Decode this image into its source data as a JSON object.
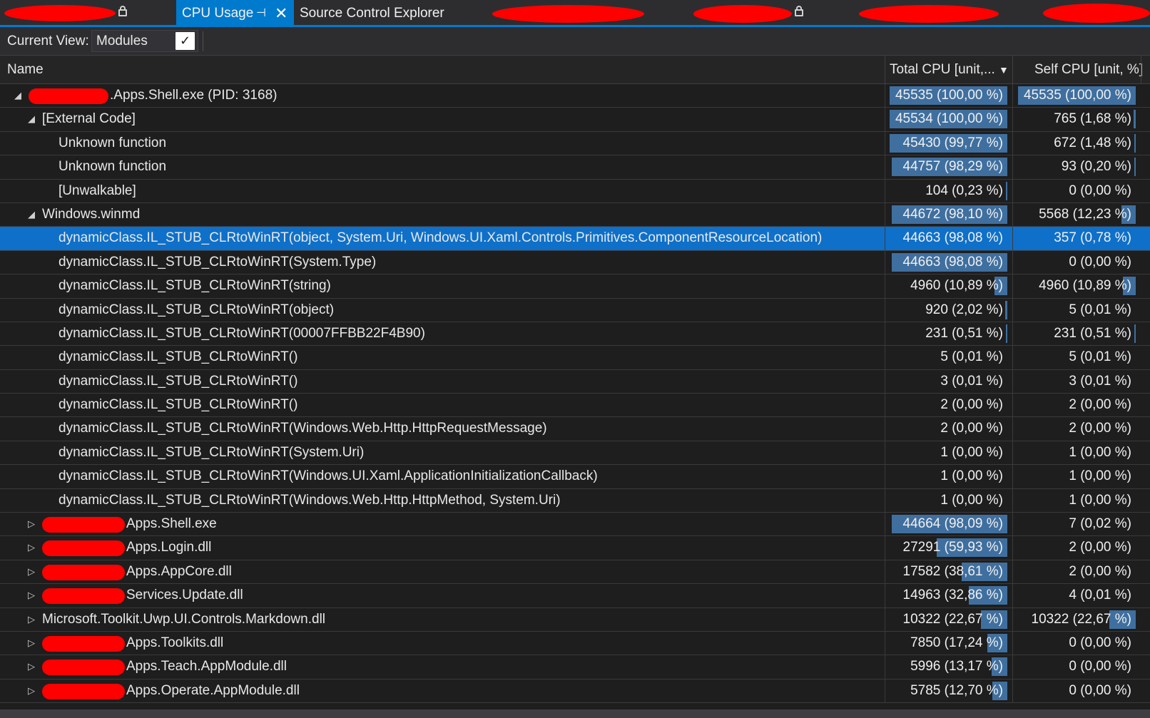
{
  "tabs": {
    "active_label": "CPU Usage",
    "pin_glyph": "⊣",
    "close_glyph": "✕",
    "second_label": "Source Control Explorer"
  },
  "toolbar": {
    "view_label": "Current View:",
    "view_value": "Modules",
    "dropdown_glyph": "✓"
  },
  "columns": {
    "name": "Name",
    "total": "Total CPU [unit,...",
    "self": "Self CPU [unit, %]",
    "sort_glyph": "▼"
  },
  "rows": [
    {
      "name": ".Apps.Shell.exe (PID: 3168)",
      "level": 0,
      "toggle": "◢",
      "redact": true,
      "total": "45535 (100,00 %)",
      "total_pct": 100,
      "self": "45535 (100,00 %)",
      "self_pct": 100
    },
    {
      "name": "[External Code]",
      "level": 1,
      "toggle": "◢",
      "total": "45534 (100,00 %)",
      "total_pct": 100,
      "self": "765 (1,68 %)",
      "self_pct": 1.68
    },
    {
      "name": "Unknown function",
      "level": 2,
      "toggle": "",
      "total": "45430 (99,77 %)",
      "total_pct": 99.77,
      "self": "672 (1,48 %)",
      "self_pct": 1.48
    },
    {
      "name": "Unknown function",
      "level": 2,
      "toggle": "",
      "total": "44757 (98,29 %)",
      "total_pct": 98.29,
      "self": "93 (0,20 %)",
      "self_pct": 0.2
    },
    {
      "name": "[Unwalkable]",
      "level": 2,
      "toggle": "",
      "total": "104 (0,23 %)",
      "total_pct": 0.23,
      "self": "0 (0,00 %)",
      "self_pct": 0
    },
    {
      "name": "Windows.winmd",
      "level": 1,
      "toggle": "◢",
      "total": "44672 (98,10 %)",
      "total_pct": 98.1,
      "self": "5568 (12,23 %)",
      "self_pct": 12.23
    },
    {
      "name": "dynamicClass.IL_STUB_CLRtoWinRT(object, System.Uri, Windows.UI.Xaml.Controls.Primitives.ComponentResourceLocation)",
      "level": 2,
      "toggle": "",
      "selected": true,
      "total": "44663 (98,08 %)",
      "total_pct": 98.08,
      "self": "357 (0,78 %)",
      "self_pct": 0.78
    },
    {
      "name": "dynamicClass.IL_STUB_CLRtoWinRT(System.Type)",
      "level": 2,
      "toggle": "",
      "total": "44663 (98,08 %)",
      "total_pct": 98.08,
      "self": "0 (0,00 %)",
      "self_pct": 0
    },
    {
      "name": "dynamicClass.IL_STUB_CLRtoWinRT(string)",
      "level": 2,
      "toggle": "",
      "total": "4960 (10,89 %)",
      "total_pct": 10.89,
      "self": "4960 (10,89 %)",
      "self_pct": 10.89
    },
    {
      "name": "dynamicClass.IL_STUB_CLRtoWinRT(object)",
      "level": 2,
      "toggle": "",
      "total": "920 (2,02 %)",
      "total_pct": 2.02,
      "self": "5 (0,01 %)",
      "self_pct": 0.01
    },
    {
      "name": "dynamicClass.IL_STUB_CLRtoWinRT(00007FFBB22F4B90)",
      "level": 2,
      "toggle": "",
      "total": "231 (0,51 %)",
      "total_pct": 0.51,
      "self": "231 (0,51 %)",
      "self_pct": 0.51
    },
    {
      "name": "dynamicClass.IL_STUB_CLRtoWinRT()",
      "level": 2,
      "toggle": "",
      "total": "5 (0,01 %)",
      "total_pct": 0.01,
      "self": "5 (0,01 %)",
      "self_pct": 0.01
    },
    {
      "name": "dynamicClass.IL_STUB_CLRtoWinRT()",
      "level": 2,
      "toggle": "",
      "total": "3 (0,01 %)",
      "total_pct": 0.01,
      "self": "3 (0,01 %)",
      "self_pct": 0.01
    },
    {
      "name": "dynamicClass.IL_STUB_CLRtoWinRT()",
      "level": 2,
      "toggle": "",
      "total": "2 (0,00 %)",
      "total_pct": 0,
      "self": "2 (0,00 %)",
      "self_pct": 0
    },
    {
      "name": "dynamicClass.IL_STUB_CLRtoWinRT(Windows.Web.Http.HttpRequestMessage)",
      "level": 2,
      "toggle": "",
      "total": "2 (0,00 %)",
      "total_pct": 0,
      "self": "2 (0,00 %)",
      "self_pct": 0
    },
    {
      "name": "dynamicClass.IL_STUB_CLRtoWinRT(System.Uri)",
      "level": 2,
      "toggle": "",
      "total": "1 (0,00 %)",
      "total_pct": 0,
      "self": "1 (0,00 %)",
      "self_pct": 0
    },
    {
      "name": "dynamicClass.IL_STUB_CLRtoWinRT(Windows.UI.Xaml.ApplicationInitializationCallback)",
      "level": 2,
      "toggle": "",
      "total": "1 (0,00 %)",
      "total_pct": 0,
      "self": "1 (0,00 %)",
      "self_pct": 0
    },
    {
      "name": "dynamicClass.IL_STUB_CLRtoWinRT(Windows.Web.Http.HttpMethod, System.Uri)",
      "level": 2,
      "toggle": "",
      "total": "1 (0,00 %)",
      "total_pct": 0,
      "self": "1 (0,00 %)",
      "self_pct": 0
    },
    {
      "name": "Apps.Shell.exe",
      "level": 1,
      "toggle": "▷",
      "redact": true,
      "total": "44664 (98,09 %)",
      "total_pct": 98.09,
      "self": "7 (0,02 %)",
      "self_pct": 0.02
    },
    {
      "name": "Apps.Login.dll",
      "level": 1,
      "toggle": "▷",
      "redact": true,
      "total": "27291 (59,93 %)",
      "total_pct": 59.93,
      "self": "2 (0,00 %)",
      "self_pct": 0
    },
    {
      "name": "Apps.AppCore.dll",
      "level": 1,
      "toggle": "▷",
      "redact": true,
      "total": "17582 (38,61 %)",
      "total_pct": 38.61,
      "self": "2 (0,00 %)",
      "self_pct": 0
    },
    {
      "name": "Services.Update.dll",
      "level": 1,
      "toggle": "▷",
      "redact": true,
      "total": "14963 (32,86 %)",
      "total_pct": 32.86,
      "self": "4 (0,01 %)",
      "self_pct": 0.01
    },
    {
      "name": "Microsoft.Toolkit.Uwp.UI.Controls.Markdown.dll",
      "level": 1,
      "toggle": "▷",
      "total": "10322 (22,67 %)",
      "total_pct": 22.67,
      "self": "10322 (22,67 %)",
      "self_pct": 22.67
    },
    {
      "name": "Apps.Toolkits.dll",
      "level": 1,
      "toggle": "▷",
      "redact": true,
      "total": "7850 (17,24 %)",
      "total_pct": 17.24,
      "self": "0 (0,00 %)",
      "self_pct": 0
    },
    {
      "name": "Apps.Teach.AppModule.dll",
      "level": 1,
      "toggle": "▷",
      "redact": true,
      "total": "5996 (13,17 %)",
      "total_pct": 13.17,
      "self": "0 (0,00 %)",
      "self_pct": 0
    },
    {
      "name": "Apps.Operate.AppModule.dll",
      "level": 1,
      "toggle": "▷",
      "redact": true,
      "total": "5785 (12,70 %)",
      "total_pct": 12.7,
      "self": "0 (0,00 %)",
      "self_pct": 0
    }
  ],
  "colors": {
    "accent": "#007acc",
    "bar": "#3f6f9f",
    "selected_row": "#0e70c9",
    "redaction": "#ff0000"
  }
}
